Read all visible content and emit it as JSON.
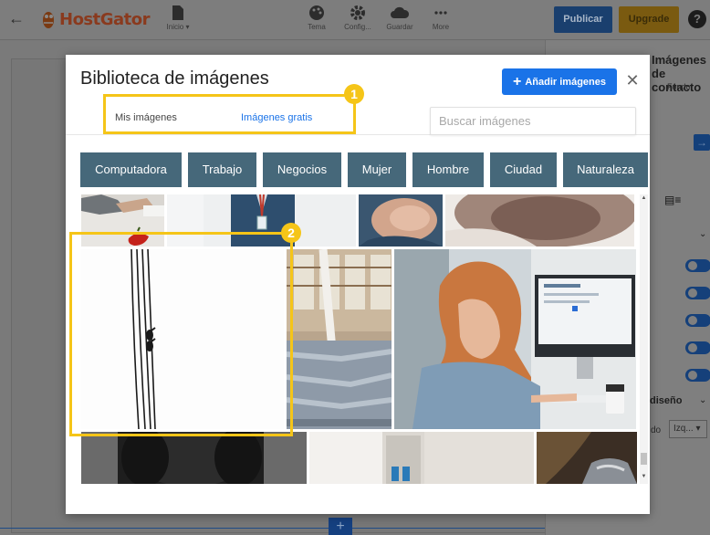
{
  "topbar": {
    "back_icon": "arrow-left-icon",
    "logo_text": "HostGator",
    "items": [
      {
        "label": "Inicio",
        "icon": "page-icon"
      },
      {
        "label": "Tema",
        "icon": "palette-icon"
      },
      {
        "label": "Config...",
        "icon": "gear-icon"
      },
      {
        "label": "Guardar",
        "icon": "cloud-icon"
      },
      {
        "label": "More",
        "icon": "more-icon"
      }
    ],
    "publish_label": "Publicar",
    "upgrade_label": "Upgrade",
    "help_label": "?",
    "colors": {
      "publish": "#1a3f6e",
      "upgrade": "#7a5a10"
    }
  },
  "side_panel": {
    "title": "Imágenes de contacto",
    "fondo_label": "Fondo",
    "diseno_label": "diseño",
    "align_label": "do",
    "select_value": "Izq..."
  },
  "modal": {
    "title": "Biblioteca de imágenes",
    "add_button_label": "Añadir imágenes",
    "close_icon": "close-icon",
    "tabs": [
      {
        "label": "Mis imágenes",
        "active": false
      },
      {
        "label": "Imágenes gratis",
        "active": true
      }
    ],
    "search_placeholder": "Buscar imágenes",
    "categories": [
      "Computadora",
      "Trabajo",
      "Negocios",
      "Mujer",
      "Hombre",
      "Ciudad",
      "Naturaleza"
    ],
    "images": [
      "hands-desk-apple-photo",
      "person-badge-photo",
      "sleeping-baby-photo",
      "dog-nose-photo",
      "birds-on-wires-photo",
      "library-papers-photo",
      "woman-at-computer-photo",
      "black-dog-photo",
      "white-doorway-photo",
      "dark-outdoor-photo"
    ],
    "accent_color": "#1a73e8",
    "category_color": "#46687a"
  },
  "callouts": [
    {
      "number": "1",
      "color": "#f5c518"
    },
    {
      "number": "2",
      "color": "#f5c518"
    }
  ]
}
